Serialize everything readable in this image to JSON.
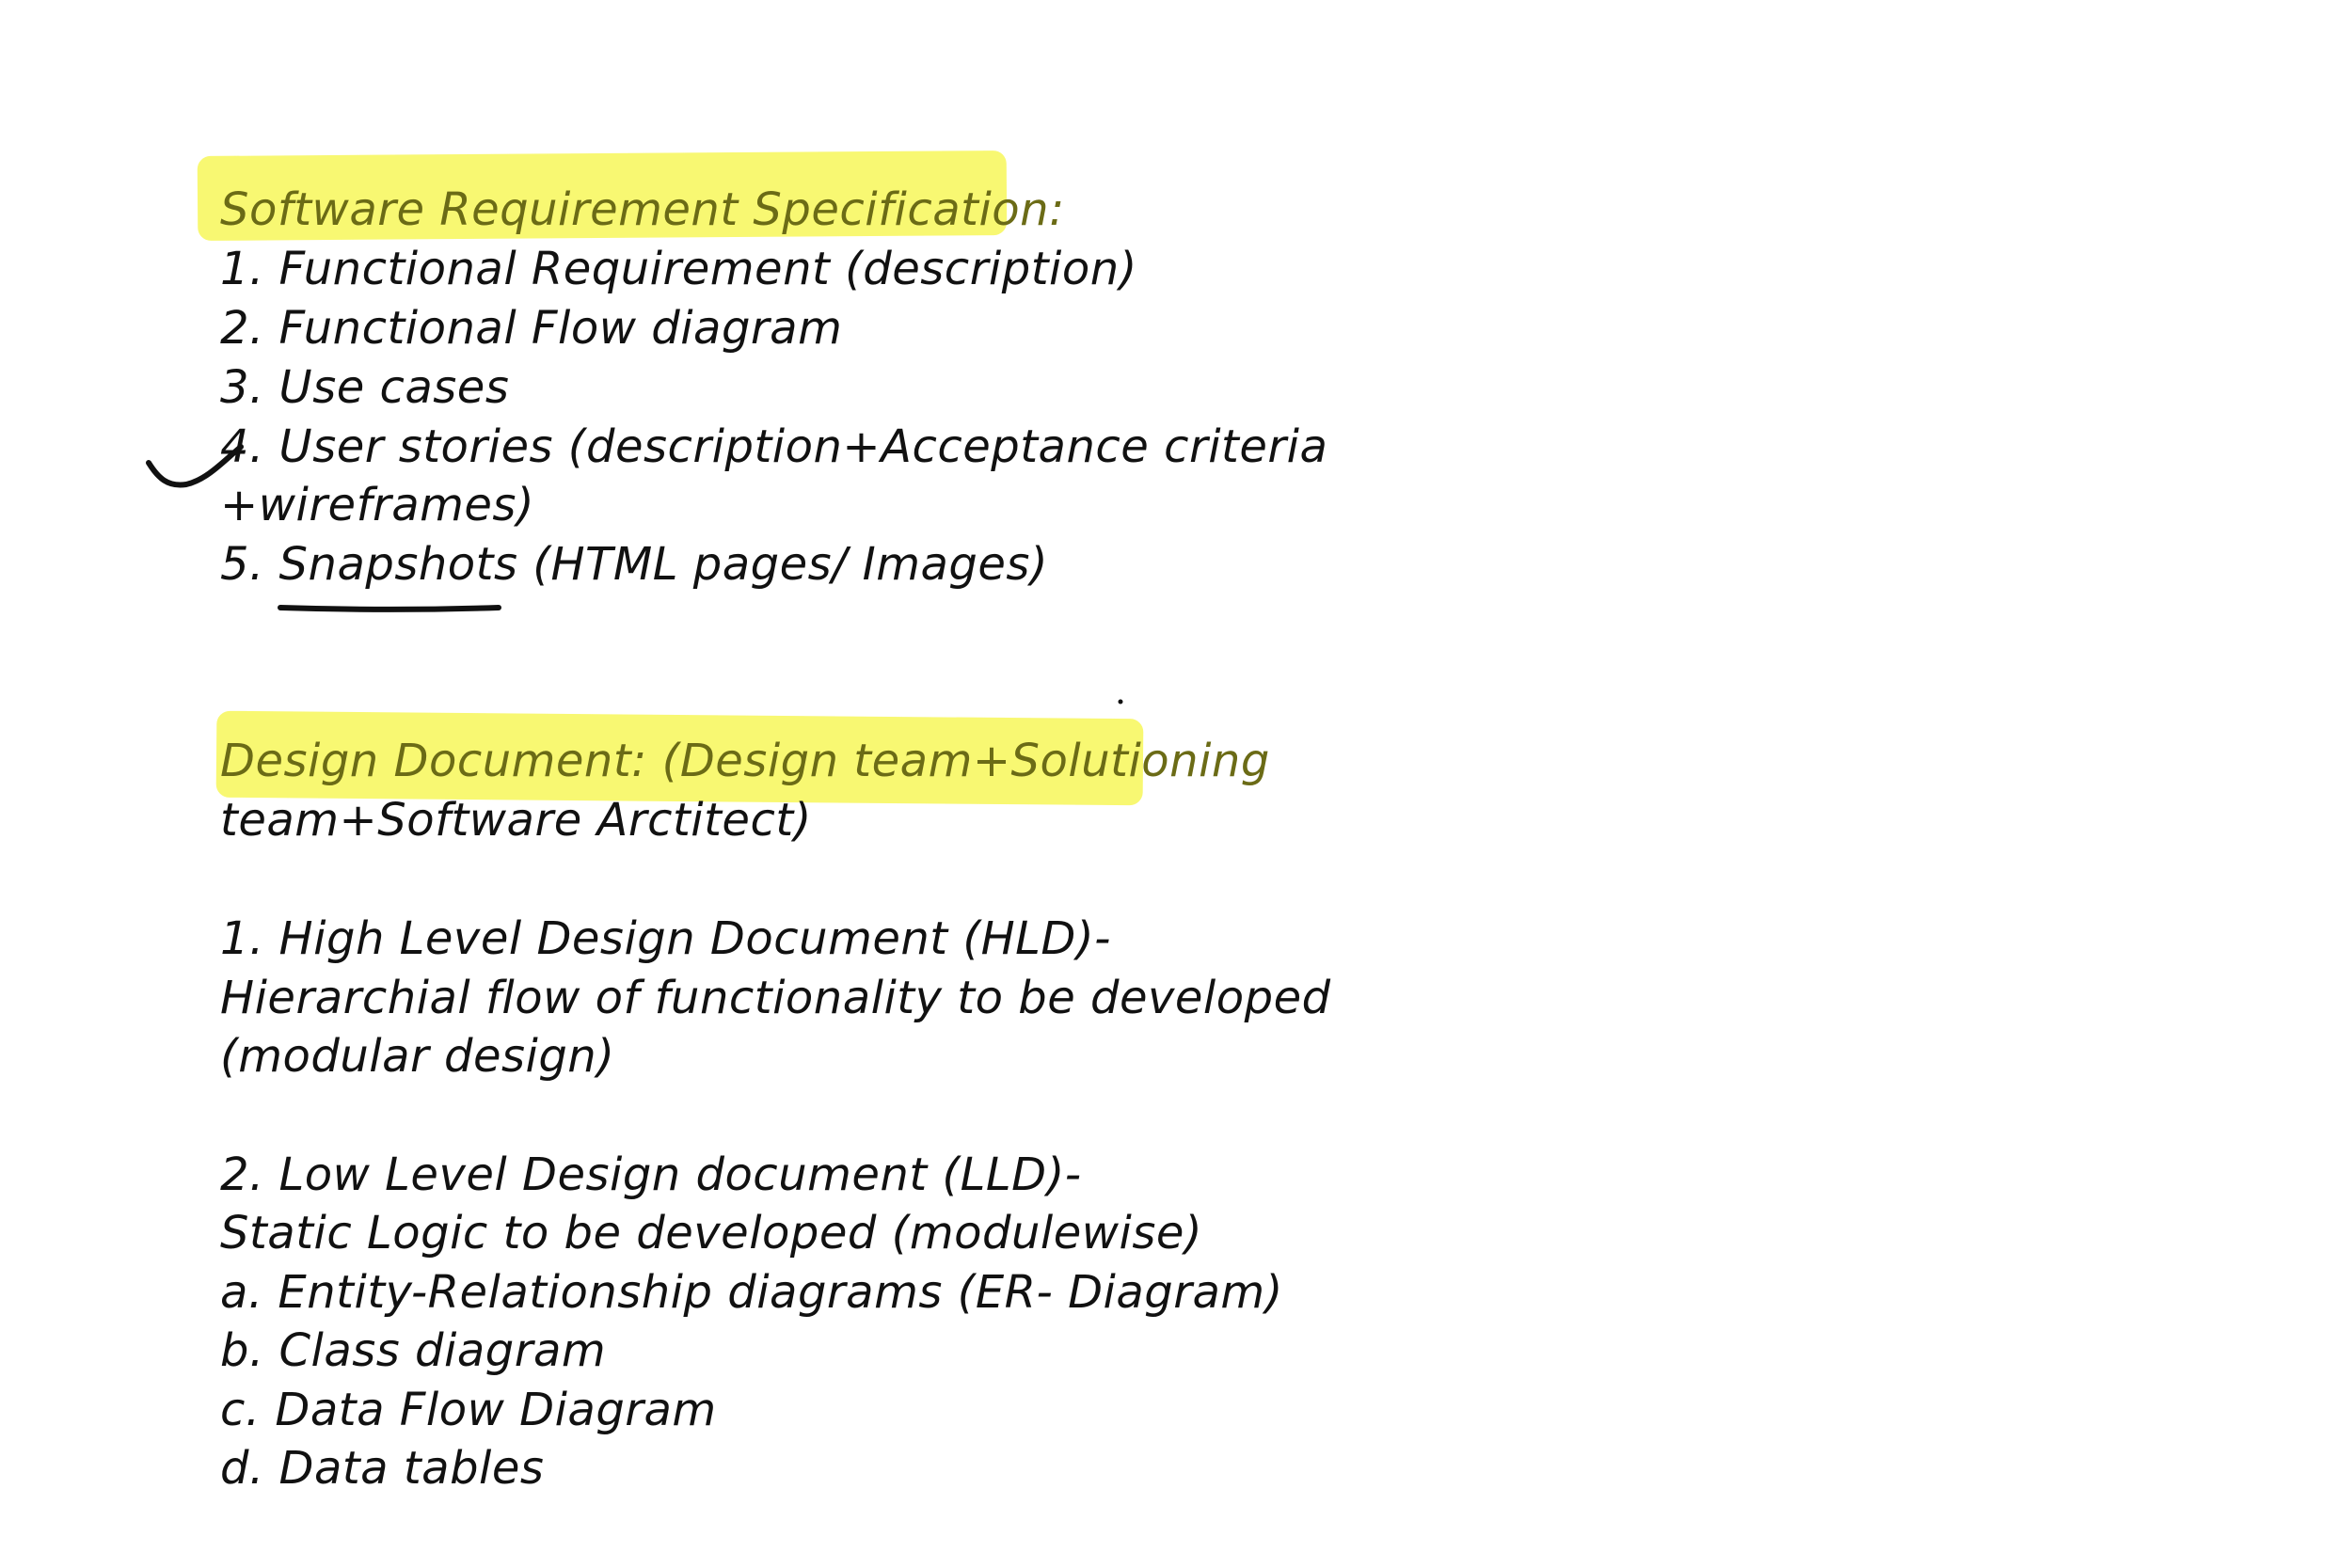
{
  "srs": {
    "heading": "Software Requirement Specification:",
    "items": [
      "1. Functional Requirement (description)",
      "2. Functional Flow diagram",
      "3. Use cases",
      "4. User stories (description+Acceptance criteria",
      "+wireframes)",
      "5. Snapshots (HTML pages/ Images)"
    ]
  },
  "design": {
    "heading": "Design Document: (Design team+Solutioning",
    "heading_cont": "team+Software Arctitect)",
    "hld": [
      "1. High Level Design Document (HLD)-",
      "Hierarchial flow of functionality to be developed",
      "(modular design)"
    ],
    "lld": [
      "2. Low Level Design document (LLD)-",
      "Static Logic to be developed (modulewise)",
      "a. Entity-Relationship diagrams (ER- Diagram)",
      "b. Class diagram",
      "c. Data Flow Diagram",
      "d. Data tables"
    ]
  },
  "colors": {
    "highlight": "#f5f53c",
    "ink": "#111111"
  }
}
